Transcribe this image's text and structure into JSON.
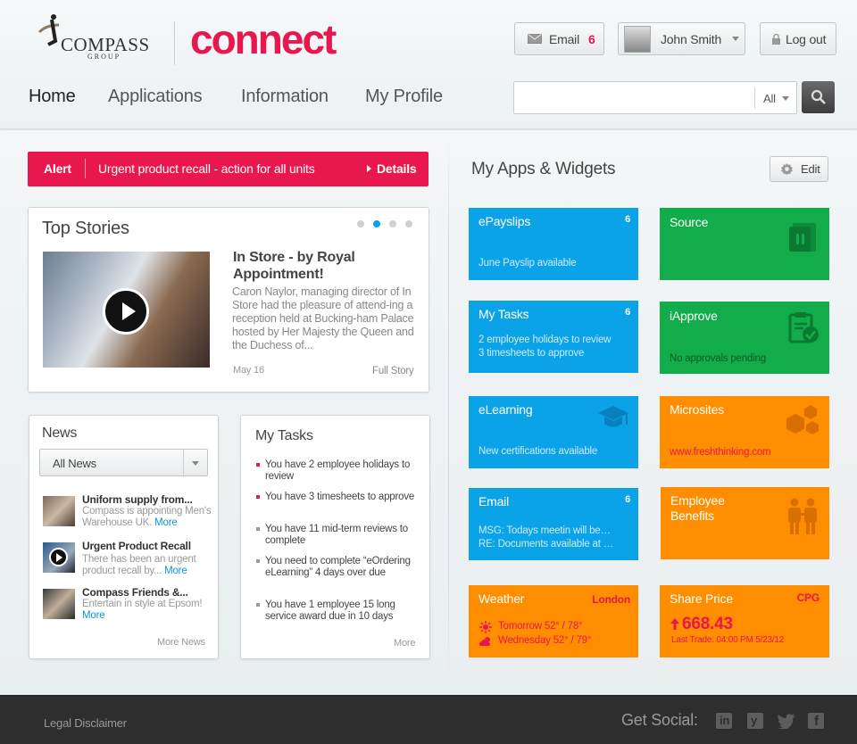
{
  "brand": {
    "compass": "COMPASS",
    "group": "GROUP",
    "connect": "connect"
  },
  "top": {
    "email_label": "Email",
    "email_count": "6",
    "user_name": "John Smith",
    "logout_label": "Log out"
  },
  "nav": {
    "home": "Home",
    "applications": "Applications",
    "information": "Information",
    "profile": "My Profile"
  },
  "search": {
    "scope": "All",
    "value": ""
  },
  "alert": {
    "label": "Alert",
    "text": "Urgent product recall - action for all units",
    "details": "Details"
  },
  "top_stories": {
    "title": "Top Stories",
    "active_dot": 1,
    "dots": 4,
    "story_title": "In Store - by Royal Appointment!",
    "story_text": "Caron Naylor, managing director of In Store had the pleasure of attend-ing a reception held at Bucking-ham Palace hosted by Her Majesty the Queen and the Duchess of...",
    "date": "May 16",
    "full_story": "Full Story"
  },
  "news": {
    "title": "News",
    "filter": "All News",
    "items": [
      {
        "title": "Uniform supply from...",
        "summary": "Compass is appointing Men's Warehouse UK.",
        "more": "More"
      },
      {
        "title": "Urgent Product Recall",
        "summary": "There has been an urgent product recall by...",
        "more": "More"
      },
      {
        "title": "Compass Friends &...",
        "summary": "Entertain in style at Epsom!",
        "more": "More"
      }
    ],
    "more_news": "More News"
  },
  "tasks": {
    "title": "My Tasks",
    "items": [
      {
        "text": "You have 2 employee holidays to review",
        "color": "#e8174e"
      },
      {
        "text": "You have 3 timesheets to approve",
        "color": "#e8174e"
      },
      {
        "text": "You have 11 mid-term reviews to complete",
        "color": "#999999"
      },
      {
        "text": "You need to complete “eOrdering eLearning” 4 days over due",
        "color": "#999999"
      },
      {
        "text": "You have 1 employee 15 long service award due in 10 days",
        "color": "#999999"
      }
    ],
    "more": "More"
  },
  "apps": {
    "title": "My Apps & Widgets",
    "edit": "Edit",
    "epayslips": {
      "title": "ePayslips",
      "count": "6",
      "sub": "June Payslip available"
    },
    "source": {
      "title": "Source"
    },
    "mytasks": {
      "title": "My Tasks",
      "count": "6",
      "sub1": "2 employee holidays to review",
      "sub2": "3 timesheets to approve"
    },
    "iapprove": {
      "title": "iApprove",
      "sub": "No approvals pending"
    },
    "elearning": {
      "title": "eLearning",
      "sub": "New certifications available"
    },
    "microsites": {
      "title": "Microsites",
      "sub": "www.freshthinking.com"
    },
    "email": {
      "title": "Email",
      "count": "6",
      "sub1": "MSG: Todays meetin will be…",
      "sub2": "RE: Documents available at …"
    },
    "benefits": {
      "title": "Employee Benefits"
    },
    "weather": {
      "title": "Weather",
      "location": "London",
      "tomorrow": "Tomorrow 52° / 78°",
      "wednesday": "Wednesday 52° / 79°"
    },
    "share": {
      "title": "Share Price",
      "ticker": "CPG",
      "price": "668.43",
      "last_trade": "Last Trade: 04:00 PM 5/23/12"
    }
  },
  "footer": {
    "legal": "Legal Disclaimer",
    "social": "Get Social:"
  },
  "colors": {
    "accent": "#e8174e",
    "blue": "#0aa3e8",
    "green": "#12ad4a",
    "orange": "#ff8d00"
  }
}
